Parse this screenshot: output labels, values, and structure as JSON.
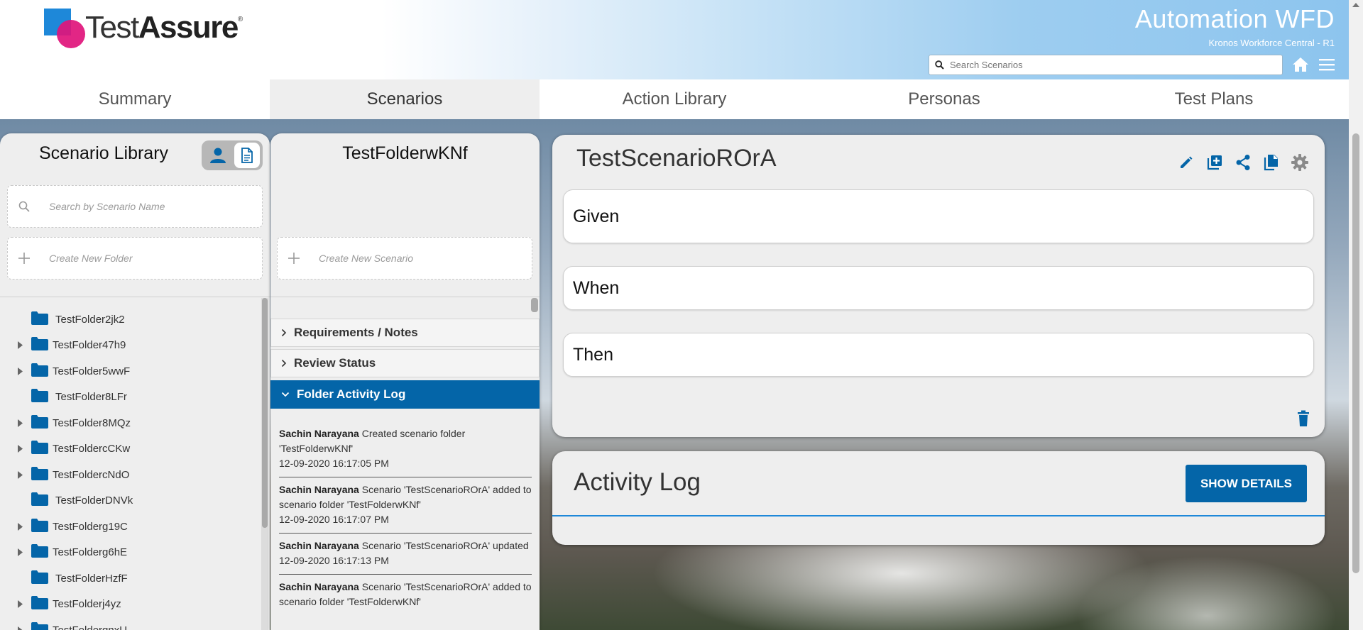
{
  "header": {
    "logo_text_light": "Test",
    "logo_text_bold": "Assure",
    "logo_registered": "®",
    "app_title": "Automation WFD",
    "app_subtitle": "Kronos Workforce Central - R1",
    "search_placeholder": "Search Scenarios",
    "icons": [
      "search-icon",
      "home-icon",
      "hamburger-menu-icon"
    ]
  },
  "tabs": [
    {
      "label": "Summary",
      "active": false
    },
    {
      "label": "Scenarios",
      "active": true
    },
    {
      "label": "Action Library",
      "active": false
    },
    {
      "label": "Personas",
      "active": false
    },
    {
      "label": "Test Plans",
      "active": false
    }
  ],
  "library": {
    "title": "Scenario Library",
    "search_placeholder": "Search by Scenario Name",
    "create_folder_label": "Create New Folder",
    "folders": [
      {
        "name": "TestFolder2jk2",
        "expandable": false
      },
      {
        "name": "TestFolder47h9",
        "expandable": true
      },
      {
        "name": "TestFolder5wwF",
        "expandable": true
      },
      {
        "name": "TestFolder8LFr",
        "expandable": false
      },
      {
        "name": "TestFolder8MQz",
        "expandable": true
      },
      {
        "name": "TestFoldercCKw",
        "expandable": true
      },
      {
        "name": "TestFoldercNdO",
        "expandable": true
      },
      {
        "name": "TestFolderDNVk",
        "expandable": false
      },
      {
        "name": "TestFolderg19C",
        "expandable": true
      },
      {
        "name": "TestFolderg6hE",
        "expandable": true
      },
      {
        "name": "TestFolderHzfF",
        "expandable": false
      },
      {
        "name": "TestFolderj4yz",
        "expandable": true
      },
      {
        "name": "TestFolderqnxU",
        "expandable": true
      }
    ]
  },
  "folder_panel": {
    "title": "TestFolderwKNf",
    "create_scenario_label": "Create New Scenario",
    "sections": {
      "requirements": "Requirements / Notes",
      "review": "Review Status",
      "activity": "Folder Activity Log"
    },
    "activity_log": [
      {
        "user": "Sachin Narayana",
        "text": "Created scenario folder 'TestFolderwKNf'",
        "time": "12-09-2020 16:17:05 PM"
      },
      {
        "user": "Sachin Narayana",
        "text": "Scenario 'TestScenarioROrA' added to scenario folder 'TestFolderwKNf'",
        "time": "12-09-2020 16:17:07 PM"
      },
      {
        "user": "Sachin Narayana",
        "text": "Scenario 'TestScenarioROrA' updated",
        "time": "12-09-2020 16:17:13 PM"
      },
      {
        "user": "Sachin Narayana",
        "text": "Scenario 'TestScenarioROrA' added to scenario folder 'TestFolderwKNf'",
        "time": ""
      }
    ]
  },
  "scenario": {
    "title": "TestScenarioROrA",
    "steps": {
      "given": "Given",
      "when": "When",
      "then": "Then"
    },
    "tools": [
      "edit-icon",
      "add-to-library-icon",
      "share-icon",
      "copy-icon",
      "settings-icon"
    ]
  },
  "activity": {
    "title": "Activity Log",
    "button_label": "SHOW DETAILS"
  },
  "colors": {
    "brand_blue": "#0465a8",
    "accent_blue": "#1e88d9",
    "logo_pink": "#e0147b",
    "panel_bg": "#eeeeee"
  }
}
